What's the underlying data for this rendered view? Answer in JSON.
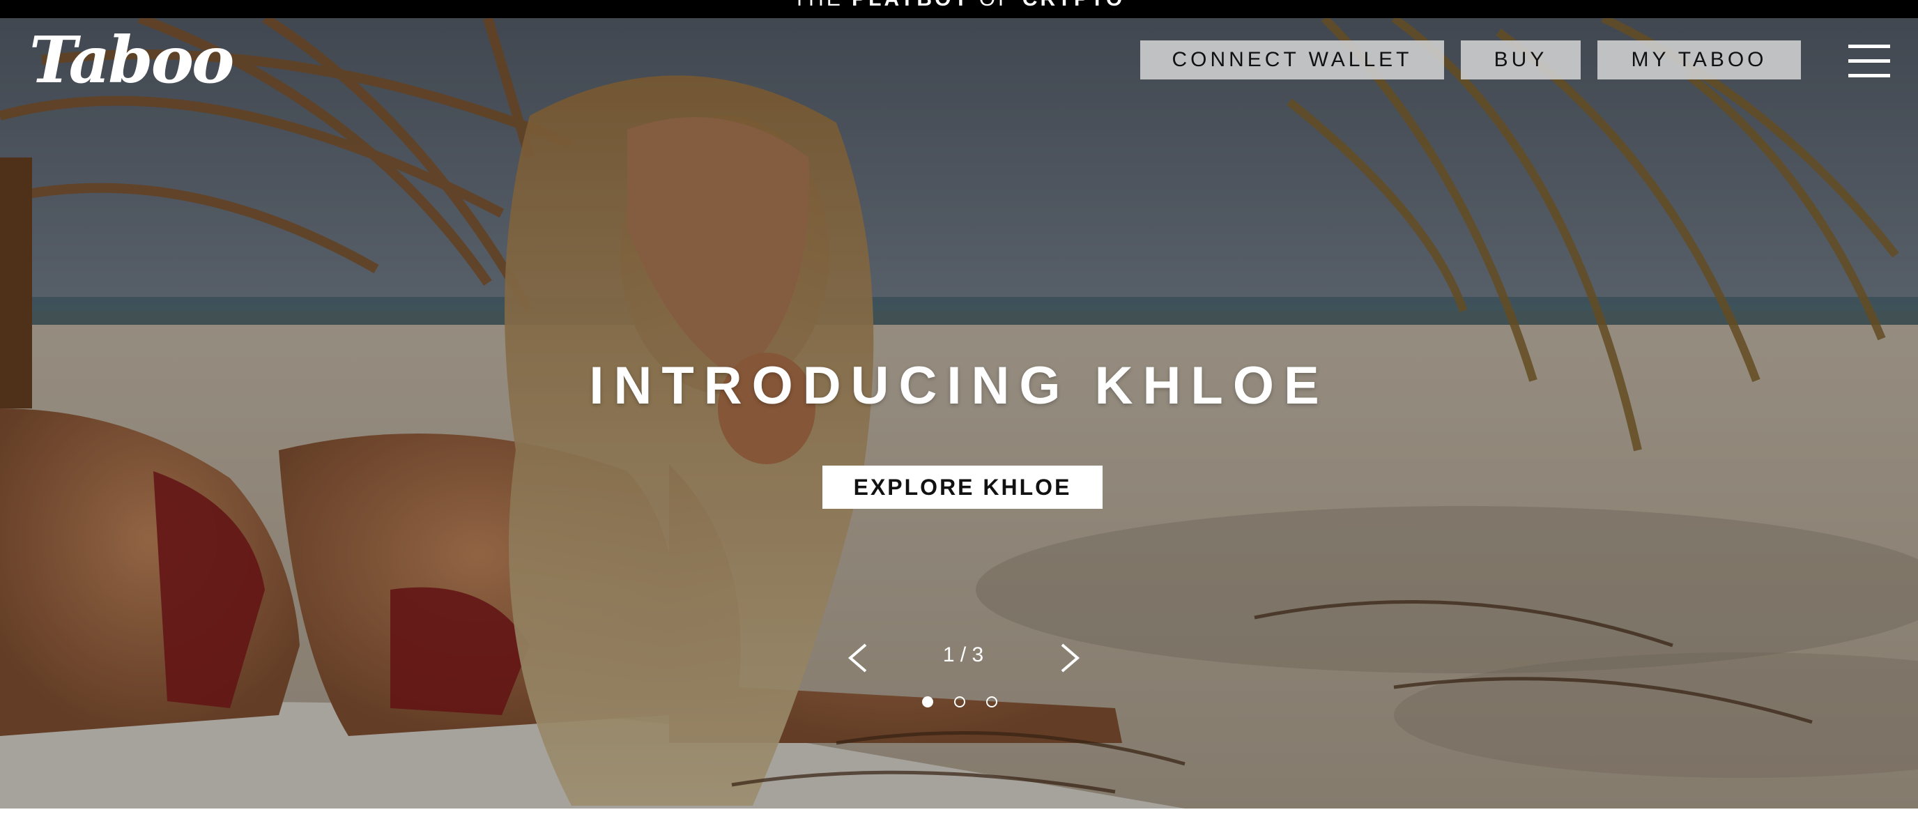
{
  "top_banner": {
    "prefix": "THE",
    "bold_1": "PLAYBOY",
    "middle": "OF",
    "bold_2": "CRYPTO"
  },
  "header": {
    "logo_text": "Taboo",
    "nav": {
      "connect_wallet": "CONNECT WALLET",
      "buy": "BUY",
      "my_taboo": "MY TABOO"
    },
    "menu_icon": "hamburger-menu-icon"
  },
  "hero": {
    "title": "INTRODUCING KHLOE",
    "cta_label": "EXPLORE KHLOE",
    "slider": {
      "counter": "1 / 3",
      "current_slide": 1,
      "total_slides": 3,
      "prev_icon": "chevron-left-icon",
      "next_icon": "chevron-right-icon"
    }
  },
  "colors": {
    "top_strip": "#000000",
    "nav_button_bg": "#d2d2d2",
    "text_light": "#ffffff",
    "text_dark": "#111111"
  }
}
